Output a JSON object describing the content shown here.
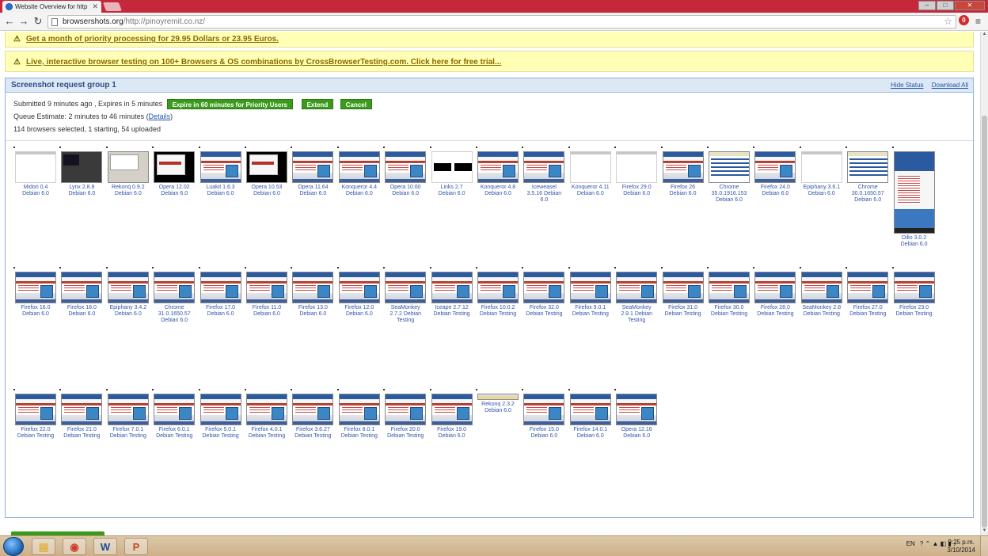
{
  "browser": {
    "tab_title": "Website Overview for http",
    "tab_close": "✕",
    "url_domain": "browsershots.org",
    "url_path": "/http://pinoyremit.co.nz/",
    "back": "←",
    "forward": "→",
    "reload": "↻",
    "star": "☆",
    "menu": "≡",
    "ext_badge": "0",
    "window_min": "–",
    "window_max": "□",
    "window_close": "✕"
  },
  "promos": [
    {
      "icon": "⚠",
      "text": "Get a month of priority processing for 29.95 Dollars or 23.95 Euros."
    },
    {
      "icon": "⚠",
      "text": "Live, interactive browser testing on 100+ Browsers & OS combinations by CrossBrowserTesting.com. Click here for free trial..."
    }
  ],
  "group": {
    "title": "Screenshot request group 1",
    "hide_status": "Hide Status",
    "download_all": "Download All",
    "submitted": "Submitted 9 minutes ago , Expires in 5 minutes",
    "priority_button": "Expire in 60 minutes for Priority Users",
    "extend_button": "Extend",
    "cancel_button": "Cancel",
    "queue_prefix": "Queue Estimate: 2 minutes to 46 minutes (",
    "queue_link": "Details",
    "queue_suffix": ")",
    "status_line": "114 browsers selected, 1 starting, 54 uploaded"
  },
  "rows": [
    [
      {
        "label": "Midori 0.4\nDebian 6.0",
        "style": "blank"
      },
      {
        "label": "Lynx 2.8.8\nDebian 6.0",
        "style": "dark"
      },
      {
        "label": "Rekonq 0.9.2\nDebian 6.0",
        "style": "gray"
      },
      {
        "label": "Opera 12.02\nDebian 6.0",
        "style": "black"
      },
      {
        "label": "Luakit 1.6.3\nDebian 6.0",
        "style": "std"
      },
      {
        "label": "Opera 10.53\nDebian 6.0",
        "style": "black"
      },
      {
        "label": "Opera 11.64\nDebian 6.0",
        "style": "std"
      },
      {
        "label": "Konqueror 4.4\nDebian 6.0",
        "style": "std"
      },
      {
        "label": "Opera 10.60\nDebian 6.0",
        "style": "std"
      },
      {
        "label": "Links 2.7\nDebian 6.0",
        "style": "textual"
      },
      {
        "label": "Konqueror 4.8\nDebian 6.0",
        "style": "std"
      },
      {
        "label": "Iceweasel\n3.5.16 Debian\n6.0",
        "style": "std"
      },
      {
        "label": "Konqueror 4.11\nDebian 6.0",
        "style": "blank"
      },
      {
        "label": "Firefox 29.0\nDebian 6.0",
        "style": "blank"
      },
      {
        "label": "Firefox 26\nDebian 6.0",
        "style": "std"
      },
      {
        "label": "Chrome\n35.0.1916.153\nDebian 6.0",
        "style": "chrome"
      },
      {
        "label": "Firefox 24.0\nDebian 6.0",
        "style": "std"
      },
      {
        "label": "Epiphany 3.6.1\nDebian 6.0",
        "style": "blank"
      },
      {
        "label": "Chrome\n30.0.1650.57\nDebian 6.0",
        "style": "chrome"
      },
      {
        "label": "Dillo 3.0.2\nDebian 6.0",
        "style": "tall"
      }
    ],
    [
      {
        "label": "Firefox 16.0\nDebian 6.0",
        "style": "std"
      },
      {
        "label": "Firefox 18.0\nDebian 6.0",
        "style": "std"
      },
      {
        "label": "Epiphany 3.4.2\nDebian 6.0",
        "style": "std"
      },
      {
        "label": "Chrome\n31.0.1650.57\nDebian 6.0",
        "style": "std"
      },
      {
        "label": "Firefox 17.0\nDebian 6.0",
        "style": "std"
      },
      {
        "label": "Firefox 11.0\nDebian 6.0",
        "style": "std"
      },
      {
        "label": "Firefox 13.0\nDebian 6.0",
        "style": "std"
      },
      {
        "label": "Firefox 12.0\nDebian 6.0",
        "style": "std"
      },
      {
        "label": "SeaMonkey\n2.7.2 Debian\nTesting",
        "style": "std"
      },
      {
        "label": "Iceape 2.7.12\nDebian Testing",
        "style": "std"
      },
      {
        "label": "Firefox 10.0.2\nDebian Testing",
        "style": "std"
      },
      {
        "label": "Firefox 32.0\nDebian Testing",
        "style": "std"
      },
      {
        "label": "Firefox 9.0.1\nDebian Testing",
        "style": "std"
      },
      {
        "label": "SeaMonkey\n2.9.1 Debian\nTesting",
        "style": "std"
      },
      {
        "label": "Firefox 31.0\nDebian Testing",
        "style": "std"
      },
      {
        "label": "Firefox 30.0\nDebian Testing",
        "style": "std"
      },
      {
        "label": "Firefox 28.0\nDebian Testing",
        "style": "std"
      },
      {
        "label": "SeaMonkey 2.8\nDebian Testing",
        "style": "std"
      },
      {
        "label": "Firefox 27.0\nDebian Testing",
        "style": "std"
      },
      {
        "label": "Firefox 23.0\nDebian Testing",
        "style": "std"
      }
    ],
    [
      {
        "label": "Firefox 22.0\nDebian Testing",
        "style": "std"
      },
      {
        "label": "Firefox 21.0\nDebian Testing",
        "style": "std"
      },
      {
        "label": "Firefox 7.0.1\nDebian Testing",
        "style": "std"
      },
      {
        "label": "Firefox 6.0.1\nDebian Testing",
        "style": "std"
      },
      {
        "label": "Firefox 5.0.1\nDebian Testing",
        "style": "std"
      },
      {
        "label": "Firefox 4.0.1\nDebian Testing",
        "style": "std"
      },
      {
        "label": "Firefox 3.6.27\nDebian Testing",
        "style": "std"
      },
      {
        "label": "Firefox 8.0.1\nDebian Testing",
        "style": "std"
      },
      {
        "label": "Firefox 20.0\nDebian Testing",
        "style": "std"
      },
      {
        "label": "Firefox 19.0\nDebian 6.0",
        "style": "std"
      },
      {
        "label": "Rekonq 2.3.2\nDebian 6.0",
        "style": "strip"
      },
      {
        "label": "Firefox 15.0\nDebian 6.0",
        "style": "std"
      },
      {
        "label": "Firefox 14.0.1\nDebian 6.0",
        "style": "std"
      },
      {
        "label": "Opera 12.16\nDebian 6.0",
        "style": "std"
      }
    ]
  ],
  "taskbar": {
    "apps": [
      {
        "name": "explorer",
        "glyph": "▤",
        "color": "#e0b040"
      },
      {
        "name": "chrome",
        "glyph": "◉",
        "color": "#d23a2a"
      },
      {
        "name": "word",
        "glyph": "W",
        "color": "#1f4e9a"
      },
      {
        "name": "powerpoint",
        "glyph": "P",
        "color": "#c74a1f"
      }
    ],
    "language": "EN",
    "tray_icons": "? ⌃ ▲ ◧ ▮ ♪",
    "time": "9:25 p.m.",
    "date": "3/10/2014"
  }
}
